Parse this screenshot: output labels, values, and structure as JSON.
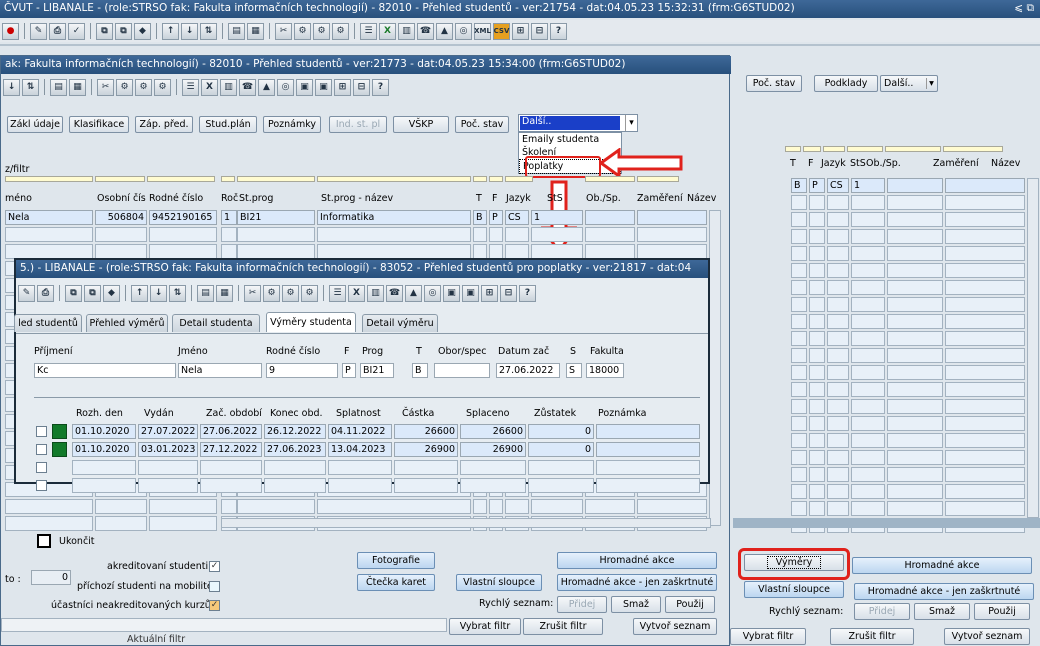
{
  "back": {
    "title": "ČVUT - LIBANALE - (role:STRSO fak: Fakulta informačních technologií) - 82010 - Přehled studentů - ver:21754 - dat:04.05.23 15:32:31 (frm:G6STUD02)",
    "poc_stav": "Poč. stav",
    "podklady": "Podklady",
    "dalsi": "Další..",
    "cols": [
      "T",
      "F",
      "Jazyk",
      "StS",
      "Ob./Sp.",
      "Zaměření",
      "Název"
    ],
    "row": [
      "B",
      "P",
      "CS",
      "1"
    ],
    "vymery": "Výměry",
    "hromadne": "Hromadné akce",
    "vlastni": "Vlastní sloupce",
    "hromadne_zaskrt": "Hromadné akce - jen zaškrtnuté",
    "rychly": "Rychlý seznam:",
    "pridej": "Přidej",
    "smaz": "Smaž",
    "pouzij": "Použij",
    "vybrat": "Vybrat filtr",
    "zrusit": "Zrušit filtr",
    "vytvor": "Vytvoř seznam"
  },
  "mid": {
    "title": "ak: Fakulta informačních technologií) - 82010 - Přehled studentů - ver:21773 - dat:04.05.23 15:34:00 (frm:G6STUD02)",
    "buttons": [
      "Zákl údaje",
      "Klasifikace",
      "Záp. před.",
      "Stud.plán",
      "Poznámky",
      "Ind. st. pl",
      "VŠKP",
      "Poč. stav"
    ],
    "dropdown": {
      "selected": "Další..",
      "options": [
        "Emaily studenta",
        "Školení",
        "Poplatky"
      ]
    },
    "filter_label": "z/filtr",
    "cols": [
      "méno",
      "Osobní čís",
      "Rodné číslo",
      "Roč",
      "St.prog",
      "St.prog - název",
      "T",
      "F",
      "Jazyk",
      "StS",
      "Ob./Sp.",
      "Zaměření",
      "Název"
    ],
    "row": {
      "jmeno": "Nela",
      "osobni": "506804",
      "rodne": "9452190165",
      "roc": "1",
      "prog": "BI21",
      "nazev": "Informatika",
      "t": "B",
      "f": "P",
      "jazyk": "CS",
      "sts": "1"
    },
    "ukoncit": "Ukončit",
    "to_label": "to :",
    "to_value": "0",
    "akred": "akreditovaní studenti",
    "prichozi": "příchozí studenti na mobilitě",
    "ucastnici": "účastníci neakreditovaných kurzů",
    "fotografie": "Fotografie",
    "ctecka": "Čtečka karet",
    "vlastni": "Vlastní sloupce",
    "hromadne": "Hromadné akce",
    "hromadne_zaskrt": "Hromadné akce - jen zaškrtnuté",
    "rychly": "Rychlý seznam:",
    "pridej": "Přidej",
    "smaz": "Smaž",
    "pouzij": "Použij",
    "vybrat": "Vybrat filtr",
    "zrusit": "Zrušit filtr",
    "vytvor": "Vytvoř seznam",
    "aktualni": "Aktuální filtr"
  },
  "front": {
    "title": "5.) - LIBANALE - (role:STRSO fak: Fakulta informačních technologií) - 83052 - Přehled studentů pro poplatky - ver:21817 - dat:04",
    "tabs": [
      "led studentů",
      "Přehled výměrů",
      "Detail studenta",
      "Výměry studenta",
      "Detail výměru"
    ],
    "labels": {
      "prijmeni": "Příjmení",
      "jmeno": "Jméno",
      "rodne": "Rodné číslo",
      "f": "F",
      "prog": "Prog",
      "t": "T",
      "obor": "Obor/spec",
      "datum": "Datum zač",
      "s": "S",
      "fakulta": "Fakulta"
    },
    "values": {
      "prijmeni": "Kc",
      "jmeno": "Nela",
      "rodne": "9",
      "f": "P",
      "prog": "BI21",
      "t": "B",
      "obor": "",
      "datum": "27.06.2022",
      "s": "S",
      "fakulta": "18000"
    },
    "cols": [
      "Rozh. den",
      "Vydán",
      "Zač. období",
      "Konec obd.",
      "Splatnost",
      "Částka",
      "Splaceno",
      "Zůstatek",
      "Poznámka"
    ],
    "rows": [
      [
        "01.10.2020",
        "27.07.2022",
        "27.06.2022",
        "26.12.2022",
        "04.11.2022",
        "26600",
        "26600",
        "0"
      ],
      [
        "01.10.2020",
        "03.01.2023",
        "27.12.2022",
        "27.06.2023",
        "13.04.2023",
        "26900",
        "26900",
        "0"
      ]
    ]
  }
}
